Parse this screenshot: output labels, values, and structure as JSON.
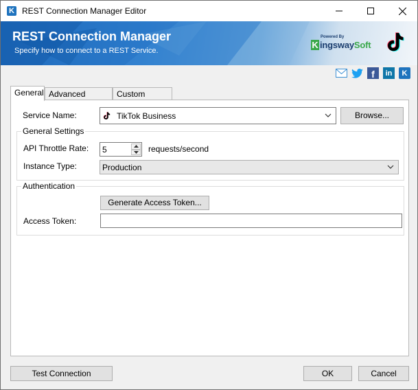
{
  "window": {
    "title": "REST Connection Manager Editor",
    "app_icon_letter": "K"
  },
  "banner": {
    "title": "REST Connection Manager",
    "subtitle": "Specify how to connect to a REST Service.",
    "kingsway_powered": "Powered By",
    "kingsway_k": "K",
    "kingsway_ingsway": "ingsway",
    "kingsway_soft": "Soft"
  },
  "social": {
    "icons": [
      "email-icon",
      "twitter-icon",
      "facebook-icon",
      "linkedin-icon",
      "kingsway-icon"
    ],
    "facebook_letter": "f",
    "linkedin_letters": "in",
    "kingsway_letter": "K"
  },
  "tabs": [
    {
      "label": "General",
      "active": true
    },
    {
      "label": "Advanced Settings",
      "active": false
    },
    {
      "label": "Custom Headers",
      "active": false
    }
  ],
  "general": {
    "service_name_label": "Service Name:",
    "service_name_value": "TikTok Business",
    "browse_label": "Browse...",
    "general_settings_title": "General Settings",
    "throttle_label": "API Throttle Rate:",
    "throttle_value": "5",
    "throttle_unit": "requests/second",
    "instance_type_label": "Instance Type:",
    "instance_type_value": "Production",
    "authentication_title": "Authentication",
    "generate_token_label": "Generate Access Token...",
    "access_token_label": "Access Token:",
    "access_token_value": ""
  },
  "footer": {
    "test_connection_label": "Test Connection",
    "ok_label": "OK",
    "cancel_label": "Cancel"
  },
  "colors": {
    "banner_blue": "#1565b8",
    "kingsway_green": "#3aa84a",
    "kingsway_navy": "#1a3d6e"
  }
}
